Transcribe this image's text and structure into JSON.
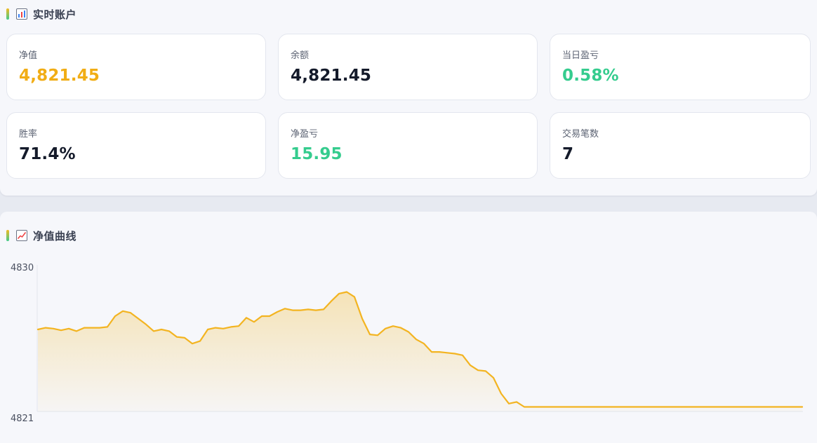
{
  "account": {
    "title": "实时账户",
    "icon": "bar-chart-icon",
    "cards": [
      {
        "label": "净值",
        "value": "4,821.45",
        "color": "#f1ad15"
      },
      {
        "label": "余额",
        "value": "4,821.45",
        "color": "#141a2a"
      },
      {
        "label": "当日盈亏",
        "value": "0.58%",
        "color": "#35cc8e"
      },
      {
        "label": "胜率",
        "value": "71.4%",
        "color": "#141a2a"
      },
      {
        "label": "净盈亏",
        "value": "15.95",
        "color": "#35cc8e"
      },
      {
        "label": "交易笔数",
        "value": "7",
        "color": "#141a2a"
      }
    ]
  },
  "equity": {
    "title": "净值曲线",
    "icon": "line-chart-icon"
  },
  "chart_data": {
    "type": "area",
    "title": "",
    "xlabel": "",
    "ylabel": "",
    "ylim": [
      4821,
      4830
    ],
    "yticks": [
      "4830",
      "4821"
    ],
    "line_color": "#f3b421",
    "grid": false,
    "series": [
      {
        "values": [
          4826.3,
          4826.4,
          4826.35,
          4826.25,
          4826.35,
          4826.2,
          4826.4,
          4826.4,
          4826.4,
          4826.45,
          4827.1,
          4827.4,
          4827.3,
          4826.95,
          4826.6,
          4826.2,
          4826.3,
          4826.2,
          4825.85,
          4825.8,
          4825.45,
          4825.6,
          4826.3,
          4826.4,
          4826.35,
          4826.45,
          4826.5,
          4827.0,
          4826.75,
          4827.1,
          4827.1,
          4827.35,
          4827.55,
          4827.45,
          4827.45,
          4827.5,
          4827.45,
          4827.5,
          4828.0,
          4828.45,
          4828.55,
          4828.25,
          4826.95,
          4826.0,
          4825.95,
          4826.35,
          4826.5,
          4826.4,
          4826.15,
          4825.7,
          4825.45,
          4824.95,
          4824.95,
          4824.9,
          4824.85,
          4824.75,
          4824.15,
          4823.85,
          4823.8,
          4823.4,
          4822.45,
          4821.85,
          4821.95,
          4821.65,
          4821.65,
          4821.65,
          4821.65,
          4821.65,
          4821.65,
          4821.65,
          4821.65,
          4821.65,
          4821.65,
          4821.65,
          4821.65,
          4821.65,
          4821.65,
          4821.65,
          4821.65,
          4821.65,
          4821.65,
          4821.65,
          4821.65,
          4821.65,
          4821.65,
          4821.65,
          4821.65,
          4821.65,
          4821.65,
          4821.65,
          4821.65,
          4821.65,
          4821.65,
          4821.65,
          4821.65,
          4821.65,
          4821.65,
          4821.65,
          4821.65,
          4821.65
        ]
      }
    ]
  }
}
